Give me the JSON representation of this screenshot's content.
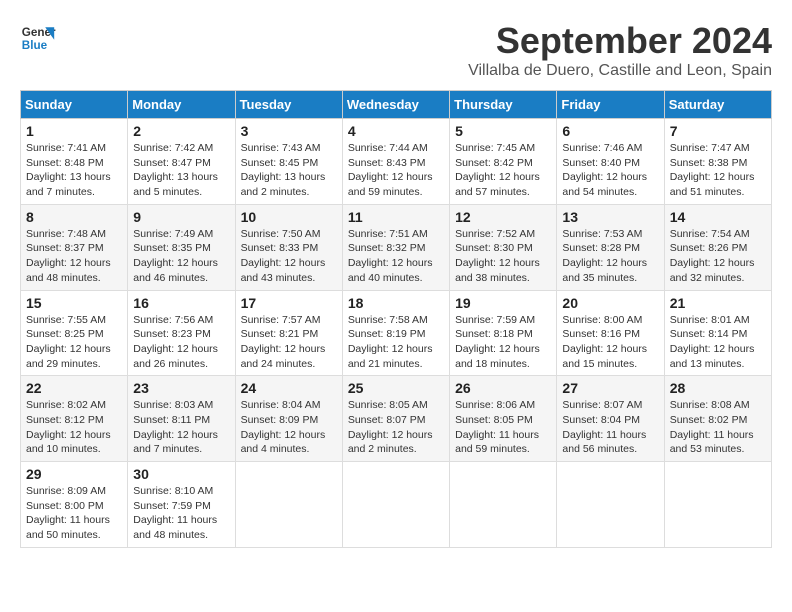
{
  "logo": {
    "line1": "General",
    "line2": "Blue"
  },
  "title": "September 2024",
  "subtitle": "Villalba de Duero, Castille and Leon, Spain",
  "days_of_week": [
    "Sunday",
    "Monday",
    "Tuesday",
    "Wednesday",
    "Thursday",
    "Friday",
    "Saturday"
  ],
  "weeks": [
    [
      {
        "day": "1",
        "sunrise": "7:41 AM",
        "sunset": "8:48 PM",
        "daylight": "13 hours and 7 minutes."
      },
      {
        "day": "2",
        "sunrise": "7:42 AM",
        "sunset": "8:47 PM",
        "daylight": "13 hours and 5 minutes."
      },
      {
        "day": "3",
        "sunrise": "7:43 AM",
        "sunset": "8:45 PM",
        "daylight": "13 hours and 2 minutes."
      },
      {
        "day": "4",
        "sunrise": "7:44 AM",
        "sunset": "8:43 PM",
        "daylight": "12 hours and 59 minutes."
      },
      {
        "day": "5",
        "sunrise": "7:45 AM",
        "sunset": "8:42 PM",
        "daylight": "12 hours and 57 minutes."
      },
      {
        "day": "6",
        "sunrise": "7:46 AM",
        "sunset": "8:40 PM",
        "daylight": "12 hours and 54 minutes."
      },
      {
        "day": "7",
        "sunrise": "7:47 AM",
        "sunset": "8:38 PM",
        "daylight": "12 hours and 51 minutes."
      }
    ],
    [
      {
        "day": "8",
        "sunrise": "7:48 AM",
        "sunset": "8:37 PM",
        "daylight": "12 hours and 48 minutes."
      },
      {
        "day": "9",
        "sunrise": "7:49 AM",
        "sunset": "8:35 PM",
        "daylight": "12 hours and 46 minutes."
      },
      {
        "day": "10",
        "sunrise": "7:50 AM",
        "sunset": "8:33 PM",
        "daylight": "12 hours and 43 minutes."
      },
      {
        "day": "11",
        "sunrise": "7:51 AM",
        "sunset": "8:32 PM",
        "daylight": "12 hours and 40 minutes."
      },
      {
        "day": "12",
        "sunrise": "7:52 AM",
        "sunset": "8:30 PM",
        "daylight": "12 hours and 38 minutes."
      },
      {
        "day": "13",
        "sunrise": "7:53 AM",
        "sunset": "8:28 PM",
        "daylight": "12 hours and 35 minutes."
      },
      {
        "day": "14",
        "sunrise": "7:54 AM",
        "sunset": "8:26 PM",
        "daylight": "12 hours and 32 minutes."
      }
    ],
    [
      {
        "day": "15",
        "sunrise": "7:55 AM",
        "sunset": "8:25 PM",
        "daylight": "12 hours and 29 minutes."
      },
      {
        "day": "16",
        "sunrise": "7:56 AM",
        "sunset": "8:23 PM",
        "daylight": "12 hours and 26 minutes."
      },
      {
        "day": "17",
        "sunrise": "7:57 AM",
        "sunset": "8:21 PM",
        "daylight": "12 hours and 24 minutes."
      },
      {
        "day": "18",
        "sunrise": "7:58 AM",
        "sunset": "8:19 PM",
        "daylight": "12 hours and 21 minutes."
      },
      {
        "day": "19",
        "sunrise": "7:59 AM",
        "sunset": "8:18 PM",
        "daylight": "12 hours and 18 minutes."
      },
      {
        "day": "20",
        "sunrise": "8:00 AM",
        "sunset": "8:16 PM",
        "daylight": "12 hours and 15 minutes."
      },
      {
        "day": "21",
        "sunrise": "8:01 AM",
        "sunset": "8:14 PM",
        "daylight": "12 hours and 13 minutes."
      }
    ],
    [
      {
        "day": "22",
        "sunrise": "8:02 AM",
        "sunset": "8:12 PM",
        "daylight": "12 hours and 10 minutes."
      },
      {
        "day": "23",
        "sunrise": "8:03 AM",
        "sunset": "8:11 PM",
        "daylight": "12 hours and 7 minutes."
      },
      {
        "day": "24",
        "sunrise": "8:04 AM",
        "sunset": "8:09 PM",
        "daylight": "12 hours and 4 minutes."
      },
      {
        "day": "25",
        "sunrise": "8:05 AM",
        "sunset": "8:07 PM",
        "daylight": "12 hours and 2 minutes."
      },
      {
        "day": "26",
        "sunrise": "8:06 AM",
        "sunset": "8:05 PM",
        "daylight": "11 hours and 59 minutes."
      },
      {
        "day": "27",
        "sunrise": "8:07 AM",
        "sunset": "8:04 PM",
        "daylight": "11 hours and 56 minutes."
      },
      {
        "day": "28",
        "sunrise": "8:08 AM",
        "sunset": "8:02 PM",
        "daylight": "11 hours and 53 minutes."
      }
    ],
    [
      {
        "day": "29",
        "sunrise": "8:09 AM",
        "sunset": "8:00 PM",
        "daylight": "11 hours and 50 minutes."
      },
      {
        "day": "30",
        "sunrise": "8:10 AM",
        "sunset": "7:59 PM",
        "daylight": "11 hours and 48 minutes."
      },
      null,
      null,
      null,
      null,
      null
    ]
  ]
}
